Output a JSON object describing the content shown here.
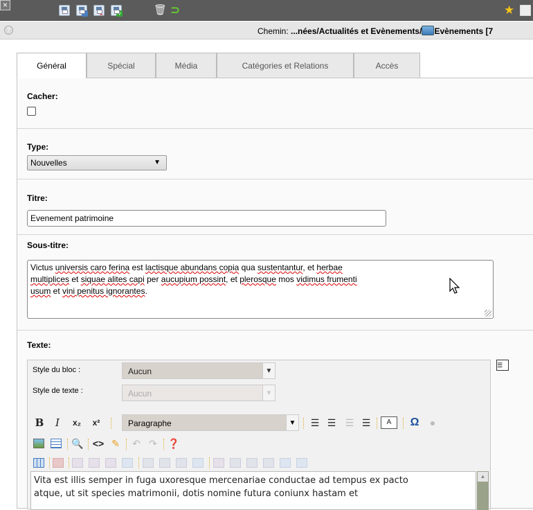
{
  "toolbar": {
    "close": "×",
    "icons": [
      "save-icon",
      "save-view-icon",
      "save-close-icon",
      "save-new-icon",
      "trash-icon",
      "undo-icon",
      "bookmark-star-icon",
      "fullscreen-icon"
    ],
    "trash_glyph": "🗑",
    "undo_glyph": "⊃",
    "star_glyph": "★"
  },
  "path": {
    "label": "Chemin:",
    "value": "...nées/Actualités et Evènements/",
    "current": "Evènements [7"
  },
  "tabs": [
    {
      "label": "Général",
      "active": true
    },
    {
      "label": "Spécial"
    },
    {
      "label": "Média"
    },
    {
      "label": "Catégories et Relations"
    },
    {
      "label": "Accès"
    }
  ],
  "form": {
    "hide": {
      "label": "Cacher:",
      "checked": false
    },
    "type": {
      "label": "Type:",
      "value": "Nouvelles"
    },
    "title": {
      "label": "Titre:",
      "value": "Evenement patrimoine"
    },
    "subtitle": {
      "label": "Sous-titre:",
      "line1a": "Victus ",
      "line1b": "universis caro ferina",
      "line1c": " est ",
      "line1d": "lactisque abundans copia",
      "line1e": " qua ",
      "line1f": "sustentantur",
      "line1g": ", et ",
      "line1h": "herbae",
      "line2a": "multiplices",
      "line2b": " et ",
      "line2c": "siquae alites capi",
      "line2d": " per ",
      "line2e": "aucupium possint",
      "line2f": ", et ",
      "line2g": "plerosque",
      "line2h": " mos ",
      "line2i": "vidimus frumenti",
      "line3a": "usum",
      "line3b": " et ",
      "line3c": "vini penitus ignorantes",
      "line3d": "."
    },
    "text": {
      "label": "Texte:"
    }
  },
  "editor": {
    "block_style_label": "Style du bloc :",
    "block_style_value": "Aucun",
    "text_style_label": "Style de texte :",
    "text_style_value": "Aucun",
    "format_value": "Paragraphe",
    "bold": "B",
    "italic": "I",
    "subscript": "x₂",
    "superscript": "x²",
    "content_line1": "Vita est illis semper in fuga uxoresque mercenariae conductae ad tempus ex pacto",
    "content_line2": "atque, ut sit species matrimonii, dotis nomine futura coniunx hastam et"
  }
}
